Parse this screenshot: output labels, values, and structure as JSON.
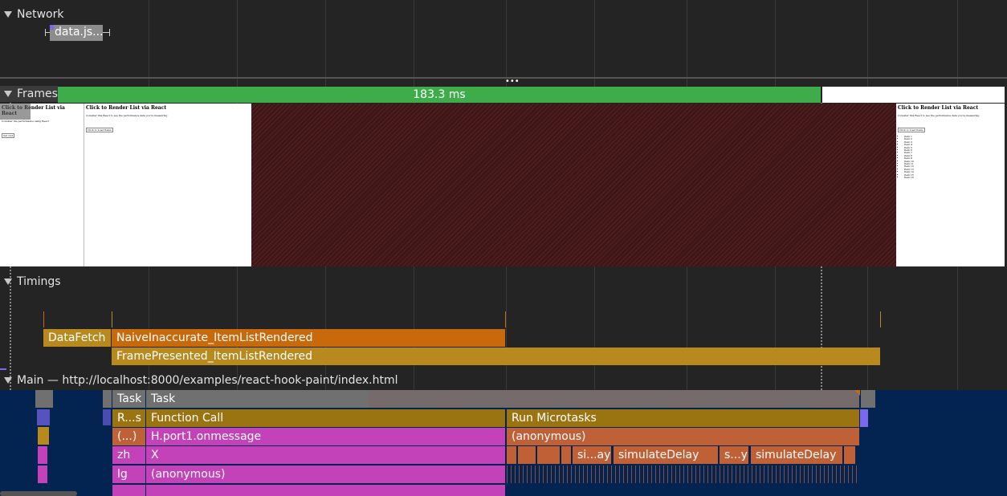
{
  "network": {
    "label": "Network",
    "request_label": "data.js..."
  },
  "frames": {
    "label": "Frames",
    "duration_label": "183.3 ms",
    "screenshot_title": "Click to Render List via React"
  },
  "timings": {
    "label": "Timings",
    "marks": [
      "DataFetch",
      "NaiveInaccurate_ItemListRendered",
      "FramePresented_ItemListRendered"
    ]
  },
  "main": {
    "label": "Main — http://localhost:8000/examples/react-hook-paint/index.html",
    "rows": {
      "r1": [
        "Task",
        "Task"
      ],
      "r2": [
        "R...s",
        "Function Call",
        "Run Microtasks"
      ],
      "r3": [
        "(...)",
        "H.port1.onmessage",
        "(anonymous)"
      ],
      "r4": [
        "zh",
        "X",
        "si...ay",
        "simulateDelay",
        "s...y",
        "simulateDelay"
      ],
      "r5": [
        "lg",
        "(anonymous)"
      ]
    }
  },
  "colors": {
    "frame_green": "#3fac4c",
    "timing_orange": "#c8690b",
    "timing_gold": "#b88a1e",
    "task_grey": "#707070",
    "function_gold": "#9b7412",
    "handler_magenta": "#c342b9",
    "anonymous_rust": "#c06037",
    "main_bg_blue": "#032351"
  }
}
